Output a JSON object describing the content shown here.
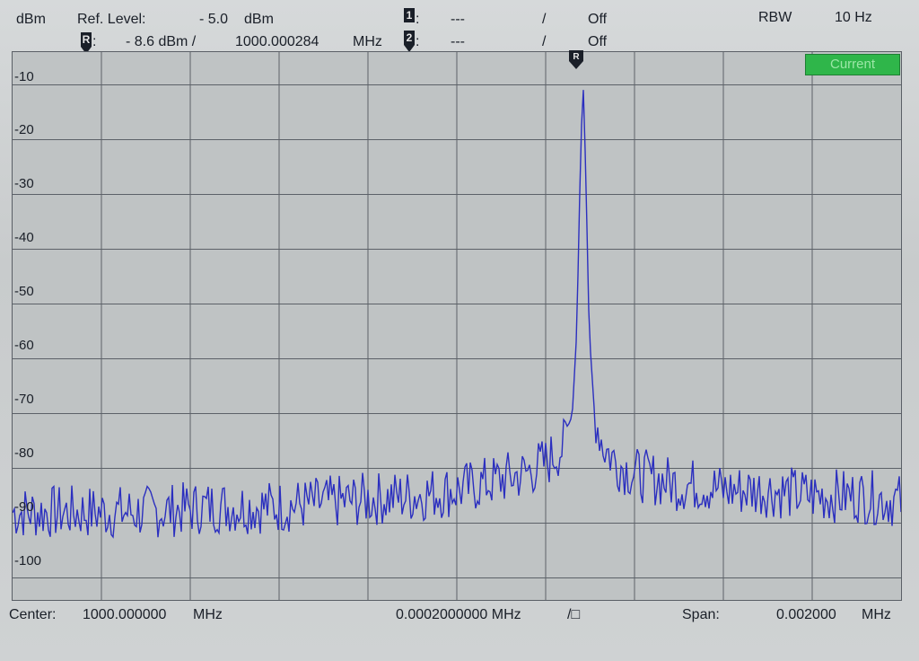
{
  "header": {
    "unit": "dBm",
    "ref_level_label": "Ref. Level:",
    "ref_level_value": "- 5.0",
    "ref_level_unit": "dBm",
    "marker_r_label": "R:",
    "marker_r_value": "- 8.6 dBm /",
    "marker_r_freq": "1000.000284",
    "marker_r_freq_unit": "MHz",
    "marker1_label": "1:",
    "marker1_value": "---",
    "marker1_sep": "/",
    "marker1_state": "Off",
    "marker2_label": "2:",
    "marker2_value": "---",
    "marker2_sep": "/",
    "marker2_state": "Off",
    "rbw_label": "RBW",
    "rbw_value": "10 Hz"
  },
  "badge": {
    "current": "Current"
  },
  "trace_marker": {
    "label": "R"
  },
  "y_axis": {
    "labels": [
      "-10",
      "-20",
      "-30",
      "-40",
      "-50",
      "-60",
      "-70",
      "-80",
      "-90",
      "-100"
    ]
  },
  "footer": {
    "center_label": "Center:",
    "center_value": "1000.000000",
    "center_unit": "MHz",
    "div_value": "0.0002000000 MHz",
    "div_suffix": "/□",
    "span_label": "Span:",
    "span_value": "0.002000",
    "span_unit": "MHz"
  },
  "colors": {
    "trace": "#2b2fbf",
    "grid": "#5c6168",
    "badge": "#2fb64a"
  },
  "chart_data": {
    "type": "line",
    "xlabel": "",
    "ylabel": "dBm",
    "ylim": [
      -105,
      -5
    ],
    "xlim": [
      999.999,
      1000.001
    ],
    "grid": true,
    "series": [
      {
        "x": [
          999.999,
          999.99915,
          999.9993,
          999.99945,
          999.9996,
          999.99975,
          999.9999,
          1000.0,
          1000.00005,
          1000.0001,
          1000.00015,
          1000.0002,
          1000.00024,
          1000.00026,
          1000.00027,
          1000.000278,
          1000.000284,
          1000.00029,
          1000.000298,
          1000.00031,
          1000.00033,
          1000.00036,
          1000.0004,
          1000.00045,
          1000.0005,
          1000.00055,
          1000.0006,
          1000.0007,
          1000.0008,
          1000.0009,
          1000.001
        ],
        "values": [
          -88,
          -88,
          -88,
          -87,
          -87,
          -86,
          -85,
          -84,
          -83,
          -82,
          -81,
          -79,
          -76,
          -70,
          -55,
          -25,
          -8.6,
          -25,
          -55,
          -70,
          -76,
          -79,
          -81,
          -82,
          -83,
          -83,
          -84,
          -84,
          -85,
          -85,
          -86
        ]
      }
    ]
  }
}
